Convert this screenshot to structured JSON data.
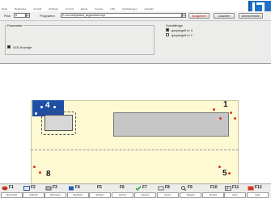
{
  "menu": {
    "items": [
      "Datei",
      "Bearbeiten",
      "Ansicht",
      "Einfügen",
      "Format",
      "Extras",
      "Fenster",
      "Hilfe",
      "Einstellungen",
      "Auswahl"
    ]
  },
  "toolbar": {
    "plan_label": "Plan",
    "plan_value": "8",
    "program_label": "Programm",
    "program_value": "E:\\cnc\\ref\\pic\\test_segmented.mpr",
    "btn_ausgeben": "Ausgeben",
    "btn_loeschen": "Löschen",
    "btn_uebernehmen": "Übernehmen"
  },
  "panel": {
    "group_label": "Parameter",
    "led_label": "LED Anzeige",
    "right_title": "Schnittfolge",
    "option_a": "gespiegelt in X",
    "option_b": "gespiegelt in Y"
  },
  "canvas": {
    "labels": {
      "n4": "4",
      "n1": "1",
      "n8": "8",
      "n5": "5"
    },
    "colors": {
      "plate": "#fdf9d3",
      "pad": "#1f4ea5",
      "marker": "#d23a1a",
      "frame": "#c6c6c6"
    }
  },
  "fkeys": [
    {
      "key": "F1",
      "cap": "Spannmittel"
    },
    {
      "key": "F2",
      "cap": "Nullpunkt"
    },
    {
      "key": "F3",
      "cap": "Rücksetzen"
    },
    {
      "key": "F4",
      "cap": "Bearbeiten"
    },
    {
      "key": "F5",
      "cap": "Einfügen"
    },
    {
      "key": "F6",
      "cap": "Löschen"
    },
    {
      "key": "F7",
      "cap": "Kopieren"
    },
    {
      "key": "F8",
      "cap": "Drehen"
    },
    {
      "key": "F9",
      "cap": "Spiegeln"
    },
    {
      "key": "F10",
      "cap": "Drucken"
    },
    {
      "key": "F11",
      "cap": "Zoom"
    },
    {
      "key": "F12",
      "cap": "Ende"
    }
  ]
}
